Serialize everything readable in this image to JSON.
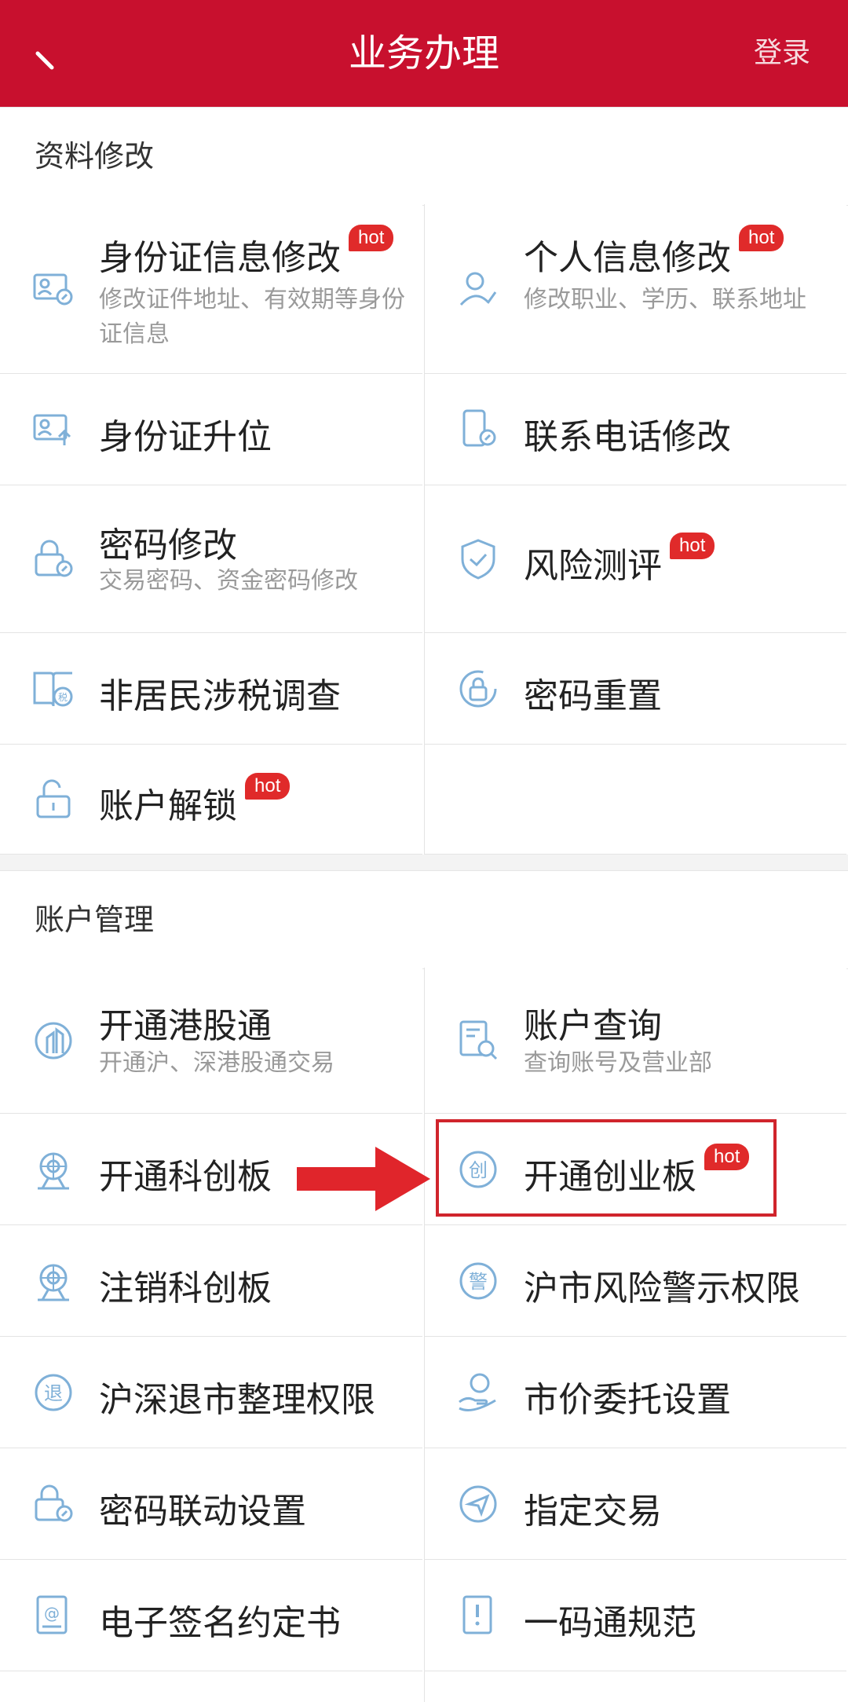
{
  "header": {
    "title": "业务办理",
    "login": "登录"
  },
  "sections": [
    {
      "title": "资料修改",
      "items": [
        {
          "label": "身份证信息修改",
          "desc": "修改证件地址、有效期等身份证信息",
          "hot": "hot",
          "icon": "id-card-edit-icon"
        },
        {
          "label": "个人信息修改",
          "desc": "修改职业、学历、联系地址",
          "hot": "hot",
          "icon": "person-edit-icon"
        },
        {
          "label": "身份证升位",
          "icon": "id-card-upgrade-icon"
        },
        {
          "label": "联系电话修改",
          "icon": "phone-edit-icon"
        },
        {
          "label": "密码修改",
          "desc": "交易密码、资金密码修改",
          "icon": "lock-edit-icon"
        },
        {
          "label": "风险测评",
          "hot": "hot",
          "icon": "shield-check-icon"
        },
        {
          "label": "非居民涉税调查",
          "icon": "tax-book-icon"
        },
        {
          "label": "密码重置",
          "icon": "lock-reset-icon"
        },
        {
          "label": "账户解锁",
          "hot": "hot",
          "icon": "unlock-icon"
        }
      ]
    },
    {
      "title": "账户管理",
      "items": [
        {
          "label": "开通港股通",
          "desc": "开通沪、深港股通交易",
          "icon": "hk-connect-icon"
        },
        {
          "label": "账户查询",
          "desc": "查询账号及营业部",
          "icon": "document-search-icon"
        },
        {
          "label": "开通科创板",
          "icon": "star-market-icon"
        },
        {
          "label": "开通创业板",
          "hot": "hot",
          "icon": "chuang-icon"
        },
        {
          "label": "注销科创板",
          "icon": "star-market-cancel-icon"
        },
        {
          "label": "沪市风险警示权限",
          "icon": "warning-seal-icon"
        },
        {
          "label": "沪深退市整理权限",
          "icon": "delisting-icon"
        },
        {
          "label": "市价委托设置",
          "icon": "hand-coin-icon"
        },
        {
          "label": "密码联动设置",
          "icon": "lock-link-icon"
        },
        {
          "label": "指定交易",
          "icon": "send-icon"
        },
        {
          "label": "电子签名约定书",
          "icon": "esign-icon"
        },
        {
          "label": "一码通规范",
          "icon": "notice-book-icon"
        }
      ]
    }
  ],
  "colors": {
    "brand": "#c8102e",
    "hot": "#e02a2a",
    "icon": "#7fb0d8",
    "highlight": "#d0242c"
  }
}
